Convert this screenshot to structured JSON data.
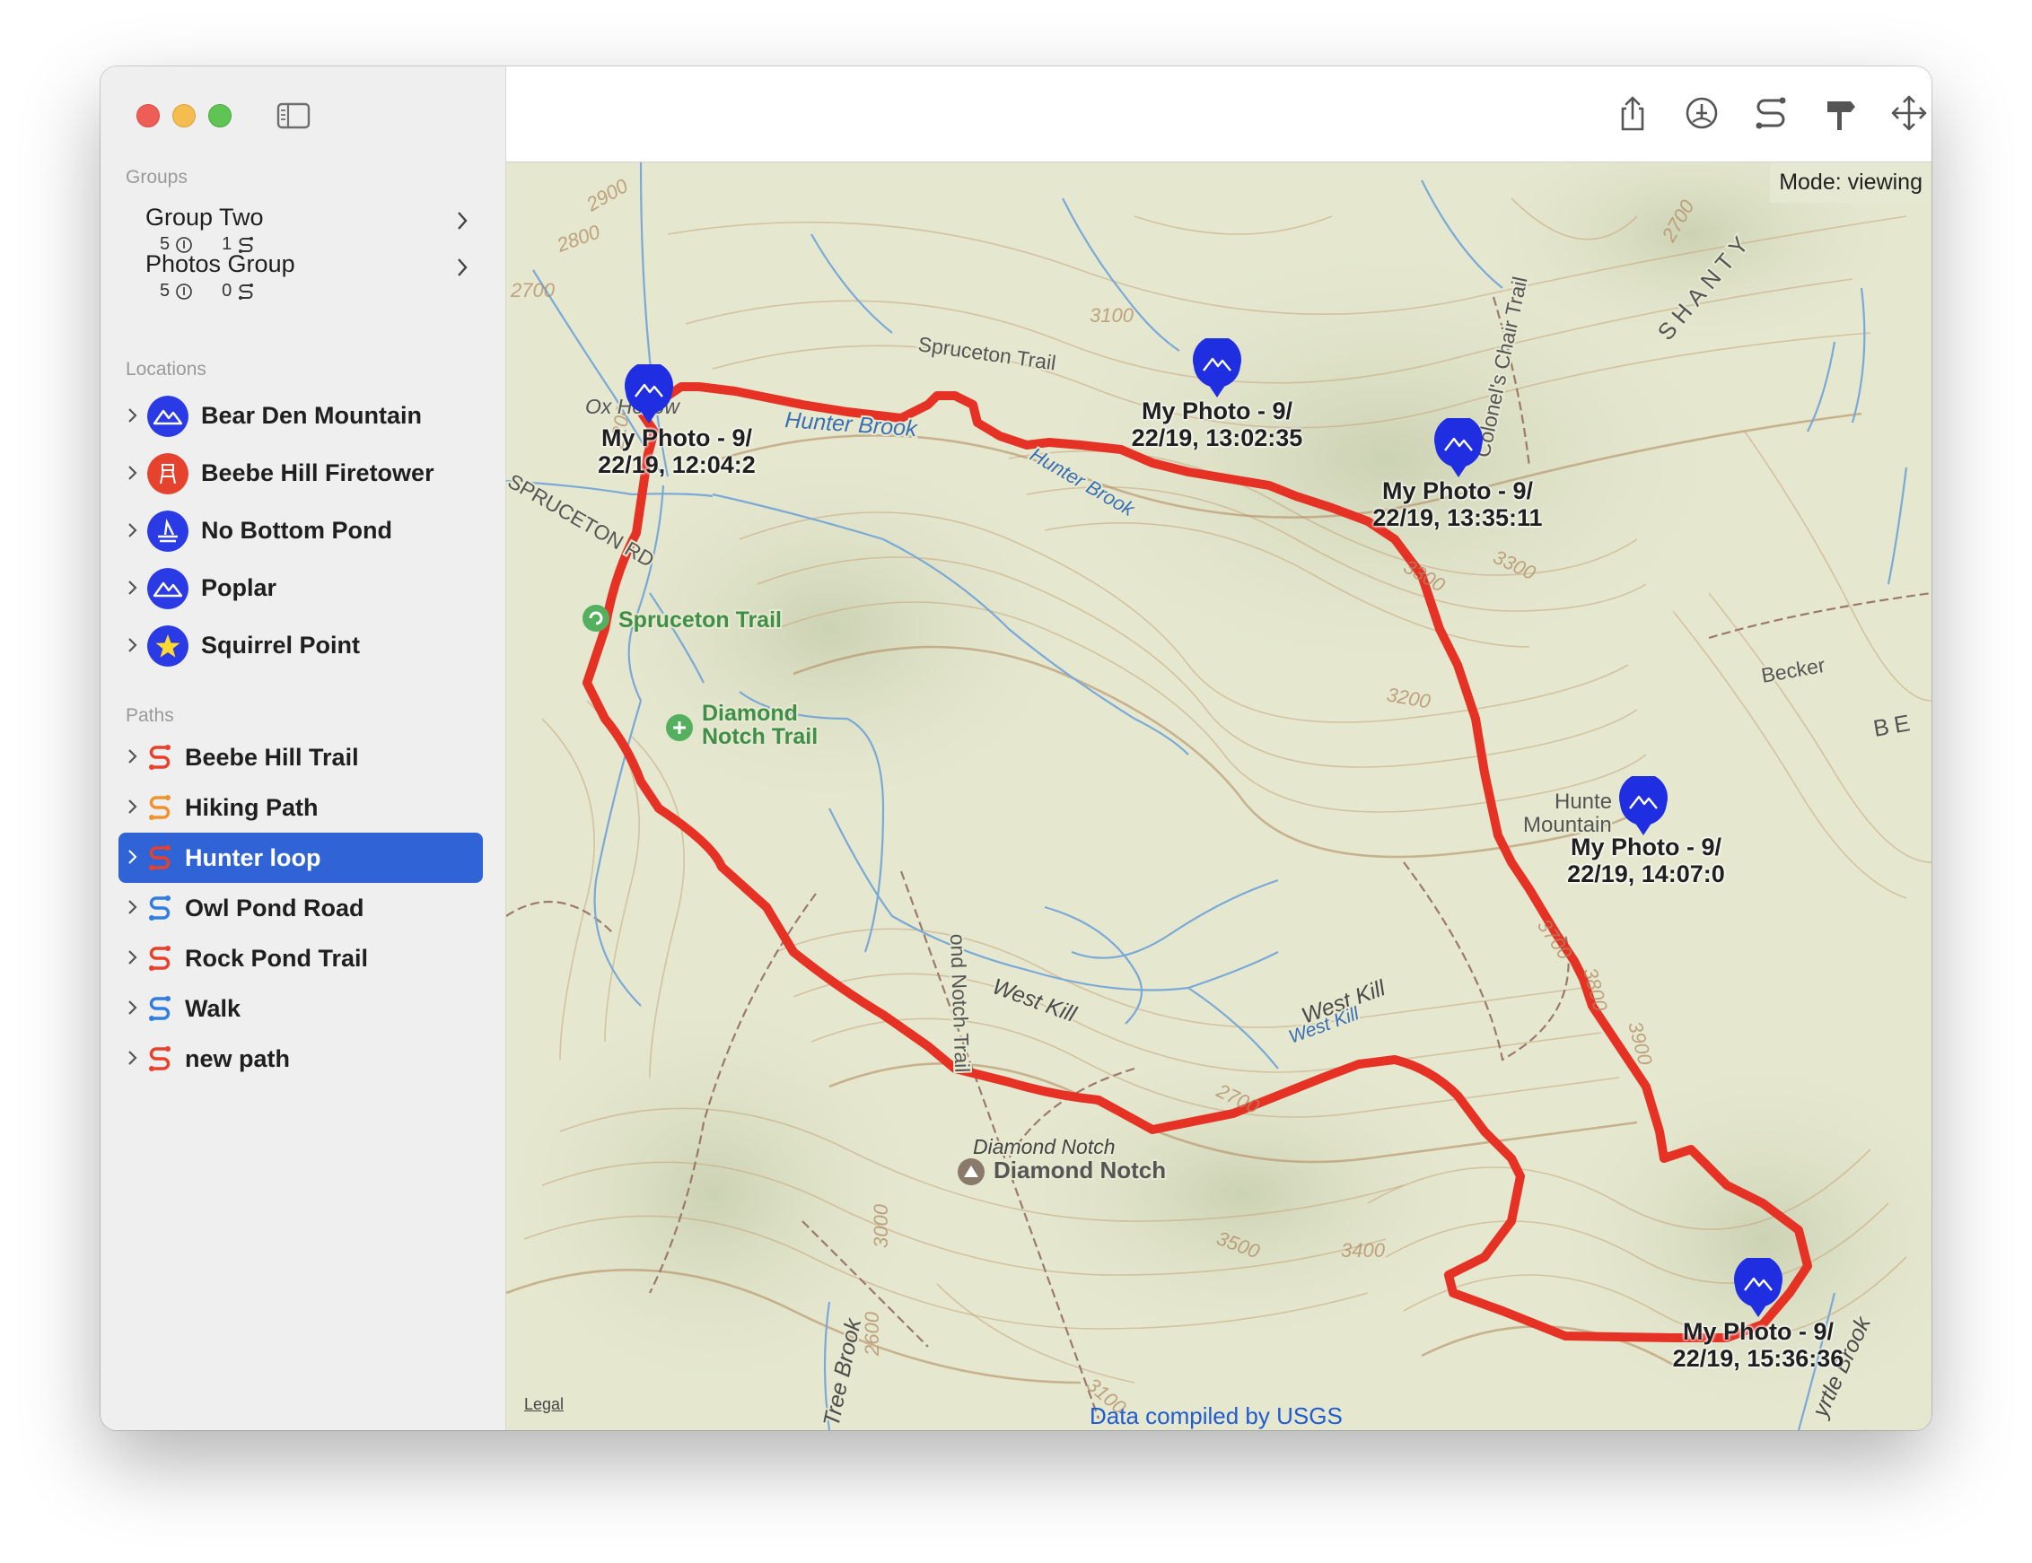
{
  "window": {
    "controls": [
      "close",
      "minimize",
      "zoom"
    ],
    "sidebar_toggle_icon": "sidebar-toggle-icon"
  },
  "sidebar": {
    "groups_label": "Groups",
    "groups": [
      {
        "title": "Group Two",
        "location_count": "5",
        "path_count": "1"
      },
      {
        "title": "Photos Group",
        "location_count": "5",
        "path_count": "0"
      }
    ],
    "locations_label": "Locations",
    "locations": [
      {
        "label": "Bear Den Mountain",
        "icon": "mountain-icon",
        "color": "#2a3be6"
      },
      {
        "label": "Beebe Hill Firetower",
        "icon": "firetower-icon",
        "color": "#e6432e"
      },
      {
        "label": "No Bottom Pond",
        "icon": "boat-icon",
        "color": "#2a3be6"
      },
      {
        "label": "Poplar",
        "icon": "mountain-icon",
        "color": "#2a3be6"
      },
      {
        "label": "Squirrel Point",
        "icon": "star-icon",
        "color": "#2a3be6"
      }
    ],
    "paths_label": "Paths",
    "paths": [
      {
        "label": "Beebe Hill Trail",
        "color": "#e8402b"
      },
      {
        "label": "Hiking Path",
        "color": "#f0922e"
      },
      {
        "label": "Hunter loop",
        "color": "#e8402b",
        "selected": true
      },
      {
        "label": "Owl Pond Road",
        "color": "#2f7de1"
      },
      {
        "label": "Rock Pond Trail",
        "color": "#e8402b"
      },
      {
        "label": "Walk",
        "color": "#2f7de1"
      },
      {
        "label": "new path",
        "color": "#e8402b"
      }
    ]
  },
  "toolbar": {
    "buttons": [
      "share-icon",
      "add-location-icon",
      "add-path-icon",
      "signpost-icon",
      "move-icon",
      "close-box-icon"
    ]
  },
  "map": {
    "mode_text": "Mode: viewing",
    "legal": "Legal",
    "credit": "Data compiled by USGS",
    "route_color": "#e53225",
    "pin_color": "#1f2ee0",
    "photo_pins": [
      {
        "line1": "My Photo - 9/",
        "line2": "22/19, 12:04:2"
      },
      {
        "line1": "My Photo - 9/",
        "line2": "22/19, 13:02:35"
      },
      {
        "line1": "My Photo - 9/",
        "line2": "22/19, 13:35:11"
      },
      {
        "line1": "My Photo - 9/",
        "line2": "22/19, 14:07:0"
      },
      {
        "line1": "My Photo - 9/",
        "line2": "22/19, 15:36:36"
      }
    ],
    "poi": {
      "spruceton_trail": "Spruceton Trail",
      "diamond_notch_trail_1": "Diamond",
      "diamond_notch_trail_2": "Notch Trail",
      "diamond_notch_label_1": "Diamond Notch",
      "diamond_notch_label_2": "Diamond Notch",
      "hunter_mountain_1": "Hunte",
      "hunter_mountain_2": "Mountain"
    },
    "labels": {
      "hunter_brook_1": "Hunter Brook",
      "hunter_brook_2": "Hunter Brook",
      "ox_hollow": "Ox Hollow",
      "spruceton_trail_line": "Spruceton Trail",
      "spruceton_rd": "SPRUCETON RD",
      "west_kill_1": "West Kill",
      "west_kill_2": "West Kill",
      "west_kill_3": "West Kill",
      "notch_trail": "ond Notch Trail",
      "colonel_chair_trail": "Colonel's Chair Trail",
      "shanty": "SHANTY",
      "becker": "Becker",
      "be": "BE",
      "tree_brook": "Tree Brook",
      "myrtle_brook": "yrtle Brook",
      "e2900": "2900",
      "e2800": "2800",
      "e2700a": "2700",
      "e2700b": "2700",
      "e3100": "3100",
      "e2200": "2200",
      "e3300": "3300",
      "e3200": "3200",
      "e3700": "3700",
      "e3800": "3800",
      "e3900": "3900",
      "e2700c": "2700",
      "e3000": "3000",
      "e2600": "2600",
      "e3500": "3500",
      "e3400": "3400",
      "e3100b": "3100",
      "e3300b": "3300"
    }
  }
}
